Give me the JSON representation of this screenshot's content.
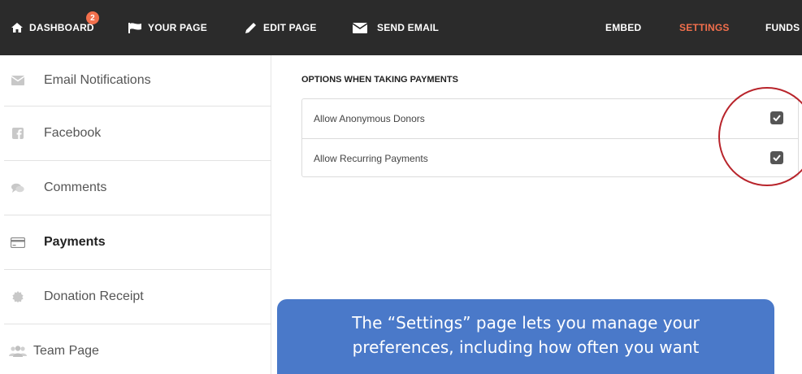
{
  "topnav": {
    "items": [
      {
        "label": "DASHBOARD",
        "icon": "home-icon",
        "badge": "2"
      },
      {
        "label": "YOUR PAGE",
        "icon": "flag-icon"
      },
      {
        "label": "EDIT PAGE",
        "icon": "pencil-icon"
      },
      {
        "label": "SEND EMAIL",
        "icon": "envelope-icon"
      },
      {
        "label": "EMBED"
      },
      {
        "label": "SETTINGS",
        "active": true
      },
      {
        "label": "FUNDS"
      }
    ],
    "active_color": "#f26f4c",
    "background": "#2b2b2b"
  },
  "sidebar": {
    "items": [
      {
        "label": "Email Notifications",
        "icon": "envelope-icon"
      },
      {
        "label": "Facebook",
        "icon": "facebook-icon"
      },
      {
        "label": "Comments",
        "icon": "comments-icon"
      },
      {
        "label": "Payments",
        "icon": "credit-card-icon",
        "active": true
      },
      {
        "label": "Donation Receipt",
        "icon": "certificate-icon"
      },
      {
        "label": "Team Page",
        "icon": "users-icon"
      }
    ]
  },
  "main": {
    "section_title": "OPTIONS WHEN TAKING PAYMENTS",
    "options": [
      {
        "label": "Allow Anonymous Donors",
        "checked": true
      },
      {
        "label": "Allow Recurring Payments",
        "checked": true
      }
    ]
  },
  "callout": {
    "line1": "The “Settings” page lets you manage your",
    "line2": "preferences, including how often you want",
    "color": "#4a79c9"
  }
}
